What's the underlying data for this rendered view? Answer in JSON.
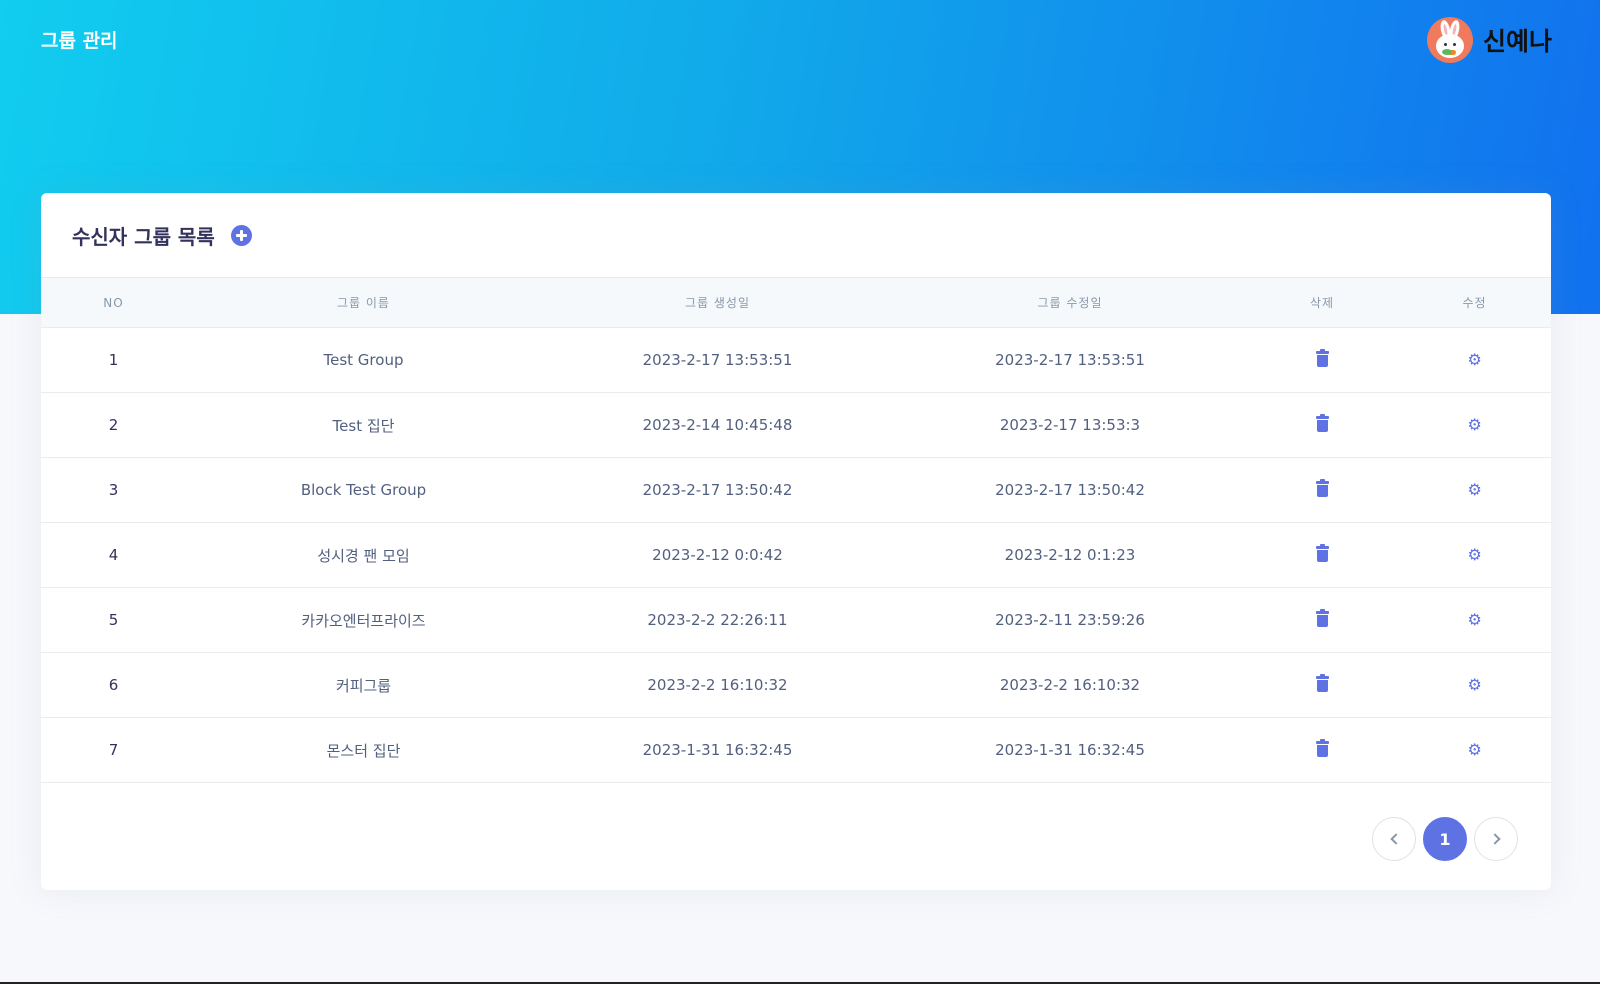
{
  "header": {
    "title": "그룹 관리",
    "user_name": "신예나"
  },
  "card": {
    "title": "수신자 그룹 목록"
  },
  "table": {
    "columns": [
      "NO",
      "그룹 이름",
      "그룹 생성일",
      "그룹 수정일",
      "삭제",
      "수정"
    ],
    "rows": [
      {
        "no": "1",
        "name": "Test Group",
        "created": "2023-2-17 13:53:51",
        "modified": "2023-2-17 13:53:51"
      },
      {
        "no": "2",
        "name": "Test 집단",
        "created": "2023-2-14 10:45:48",
        "modified": "2023-2-17 13:53:3"
      },
      {
        "no": "3",
        "name": "Block Test Group",
        "created": "2023-2-17 13:50:42",
        "modified": "2023-2-17 13:50:42"
      },
      {
        "no": "4",
        "name": "성시경 팬 모임",
        "created": "2023-2-12 0:0:42",
        "modified": "2023-2-12 0:1:23"
      },
      {
        "no": "5",
        "name": "카카오엔터프라이즈",
        "created": "2023-2-2 22:26:11",
        "modified": "2023-2-11 23:59:26"
      },
      {
        "no": "6",
        "name": "커피그룹",
        "created": "2023-2-2 16:10:32",
        "modified": "2023-2-2 16:10:32"
      },
      {
        "no": "7",
        "name": "몬스터 집단",
        "created": "2023-1-31 16:32:45",
        "modified": "2023-1-31 16:32:45"
      }
    ]
  },
  "pagination": {
    "current_page": "1"
  },
  "icons": {
    "add": "plus-circle-icon",
    "delete": "trash-icon",
    "edit": "gear-icon",
    "prev": "chevron-left-icon",
    "next": "chevron-right-icon"
  },
  "colors": {
    "accent": "#5e72e4",
    "hero_start": "#11cdef",
    "hero_end": "#1171ef"
  }
}
